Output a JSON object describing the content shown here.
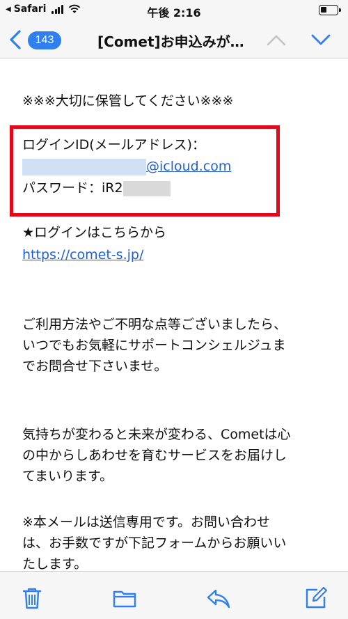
{
  "status_bar": {
    "carrier": "Safari",
    "time": "午後 2:16"
  },
  "nav": {
    "unread_count": "143",
    "title": "[Comet]お申込みが…",
    "accent_color": "#2f7ff0"
  },
  "email": {
    "notice": "※※※大切に保管してください※※※",
    "login_id_label": "ログインID(メールアドレス)：",
    "login_email_domain": "@icloud.com",
    "password_label": "パスワード：iR2",
    "login_here": "★ログインはこちらから",
    "url": "https://comet-s.jp/",
    "para1": [
      "ご利用方法やご不明な点等ございましたら、",
      "いつでもお気軽にサポートコンシェルジュま",
      "でお問合せ下さいませ。"
    ],
    "para2": [
      "気持ちが変わると未来が変わる、Cometは心",
      "の中からしあわせを育むサービスをお届けし",
      "てまいります。"
    ],
    "para3": [
      "※本メールは送信専用です。お問い合わせ",
      "は、お手数ですが下記フォームからお願いい",
      "たします。"
    ],
    "highlight_color": "#e3071a"
  },
  "toolbar": {
    "icons": [
      "trash-icon",
      "folder-icon",
      "reply-icon",
      "compose-icon"
    ]
  }
}
